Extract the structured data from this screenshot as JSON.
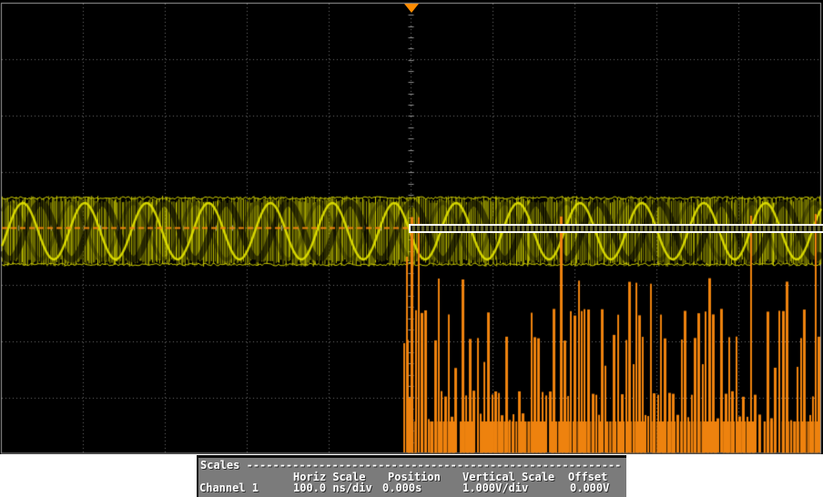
{
  "scales_panel": {
    "title_line": "Scales ---------------------------------------------------------",
    "headers": {
      "horiz_scale": "Horiz Scale",
      "position": "Position",
      "vertical_scale": "Vertical Scale",
      "offset": "Offset"
    },
    "channels": [
      {
        "label": "Channel 1",
        "horiz_scale": "100.0 ns/div",
        "position": "0.000s",
        "vertical_scale": "1.000V/div",
        "offset": "0.000V"
      }
    ]
  },
  "scope": {
    "background": "#000000",
    "grid_color": "#6f6f6f",
    "grid_tick_color": "#8f8f8f",
    "border_color": "#9d9d9d",
    "h_divisions": 10,
    "v_divisions": 8,
    "trigger_marker_color": "#ff8c00",
    "channel1_color": "#c0c000",
    "channel2_color": "#ee820e",
    "digital_band_color": "#ffffff"
  }
}
